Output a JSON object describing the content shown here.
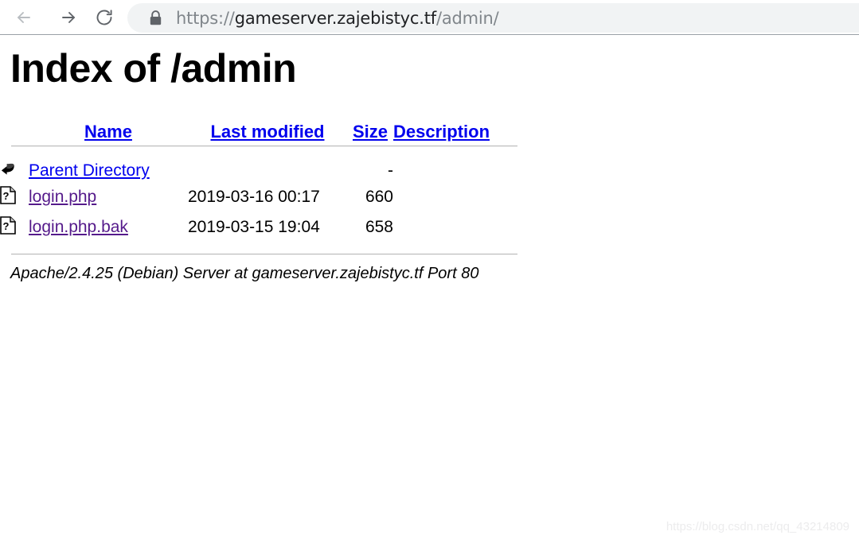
{
  "browser": {
    "back_icon": "arrow-left-icon",
    "forward_icon": "arrow-right-icon",
    "reload_icon": "reload-icon",
    "lock_icon": "lock-icon",
    "url_scheme": "https://",
    "url_host": "gameserver.zajebistyc.tf",
    "url_path": "/admin/",
    "url_full": "https://gameserver.zajebistyc.tf/admin/"
  },
  "page": {
    "title": "Index of /admin",
    "columns": {
      "name": "Name",
      "last_modified": "Last modified",
      "size": "Size",
      "description": "Description"
    },
    "rows": [
      {
        "icon": "parent-directory-icon",
        "name": "Parent Directory",
        "link_state": "unvisited",
        "last_modified": "",
        "size": "-",
        "description": ""
      },
      {
        "icon": "unknown-file-icon",
        "name": "login.php",
        "link_state": "visited",
        "last_modified": "2019-03-16 00:17",
        "size": "660",
        "description": ""
      },
      {
        "icon": "unknown-file-icon",
        "name": "login.php.bak",
        "link_state": "visited",
        "last_modified": "2019-03-15 19:04",
        "size": "658",
        "description": ""
      }
    ],
    "server_signature": "Apache/2.4.25 (Debian) Server at gameserver.zajebistyc.tf Port 80"
  },
  "watermark": "https://blog.csdn.net/qq_43214809",
  "colors": {
    "link_unvisited": "#0000ee",
    "link_visited": "#551a8b",
    "omnibox_bg": "#f1f3f4",
    "url_dim": "#80868b",
    "url_strong": "#202124"
  }
}
